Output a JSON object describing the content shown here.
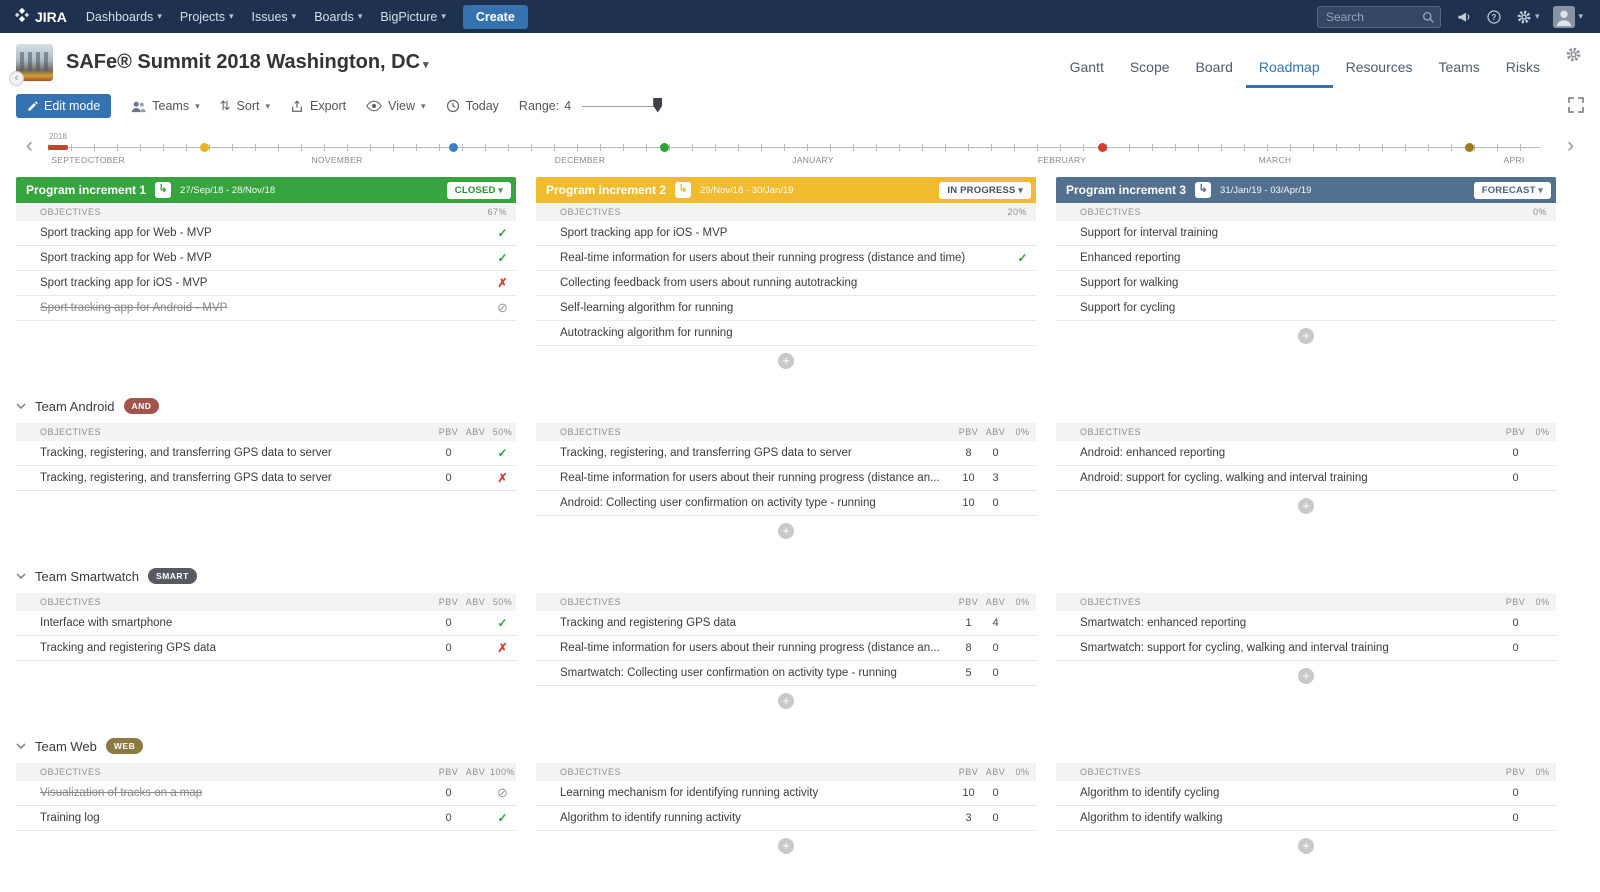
{
  "topnav": {
    "brand": "JIRA",
    "menus": [
      "Dashboards",
      "Projects",
      "Issues",
      "Boards",
      "BigPicture"
    ],
    "create_label": "Create",
    "search_placeholder": "Search"
  },
  "header": {
    "title": "SAFe® Summit 2018 Washington, DC",
    "tabs": [
      "Gantt",
      "Scope",
      "Board",
      "Roadmap",
      "Resources",
      "Teams",
      "Risks"
    ],
    "active_tab": "Roadmap"
  },
  "toolbar": {
    "edit_mode_label": "Edit mode",
    "teams_label": "Teams",
    "sort_label": "Sort",
    "export_label": "Export",
    "view_label": "View",
    "today_label": "Today",
    "range_label": "Range:",
    "range_value": "4"
  },
  "timeline": {
    "year_label": "2018",
    "months": [
      "SEPTE",
      "OCTOBER",
      "NOVEMBER",
      "DECEMBER",
      "JANUARY",
      "FEBRUARY",
      "MARCH",
      "APRI"
    ],
    "marker_colors": [
      "#e8b420",
      "#3b7fc4",
      "#2fa339",
      "#d23f31",
      "#a07d1c"
    ]
  },
  "labels": {
    "objectives": "OBJECTIVES",
    "pbv": "PBV",
    "abv": "ABV"
  },
  "increments": [
    {
      "name": "Program increment 1",
      "dates": "27/Sep/18 - 28/Nov/18",
      "status_label": "CLOSED",
      "color": "#36a53f",
      "status_text_color": "#2e8b36",
      "progress": "67%",
      "has_add": false,
      "objectives": [
        {
          "text": "Sport tracking app for Web - MVP",
          "status": "check"
        },
        {
          "text": "Sport tracking app for Web - MVP",
          "status": "check"
        },
        {
          "text": "Sport tracking app for iOS - MVP",
          "status": "cross"
        },
        {
          "text": "Sport tracking app for Android - MVP",
          "status": "cancelled"
        }
      ]
    },
    {
      "name": "Program increment 2",
      "dates": "29/Nov/18 - 30/Jan/19",
      "status_label": "IN PROGRESS",
      "color": "#f0bc2e",
      "status_text_color": "#454f5b",
      "progress": "20%",
      "has_add": true,
      "objectives": [
        {
          "text": "Sport tracking app for iOS - MVP",
          "status": ""
        },
        {
          "text": "Real-time information for users about their running progress (distance and time)",
          "status": "check"
        },
        {
          "text": "Collecting feedback from users about running autotracking",
          "status": ""
        },
        {
          "text": "Self-learning algorithm for running",
          "status": ""
        },
        {
          "text": "Autotracking algorithm for running",
          "status": ""
        }
      ]
    },
    {
      "name": "Program increment 3",
      "dates": "31/Jan/19 - 03/Apr/19",
      "status_label": "FORECAST",
      "color": "#53718f",
      "status_text_color": "#4a6583",
      "progress": "0%",
      "has_add": true,
      "objectives": [
        {
          "text": "Support for interval training",
          "status": ""
        },
        {
          "text": "Enhanced reporting",
          "status": ""
        },
        {
          "text": "Support for walking",
          "status": ""
        },
        {
          "text": "Support for cycling",
          "status": ""
        }
      ]
    }
  ],
  "teams": [
    {
      "name": "Team Android",
      "badge": "AND",
      "badge_color": "#a0564e",
      "columns": [
        {
          "progress": "50%",
          "show_abv": true,
          "has_add": false,
          "rows": [
            {
              "text": "Tracking, registering, and transferring GPS data to server",
              "pbv": "0",
              "status": "check"
            },
            {
              "text": "Tracking, registering, and transferring GPS data to server",
              "pbv": "0",
              "status": "cross"
            }
          ]
        },
        {
          "progress": "0%",
          "show_abv": true,
          "has_add": true,
          "rows": [
            {
              "text": "Tracking, registering, and transferring GPS data to server",
              "pbv": "8",
              "abv": "0"
            },
            {
              "text": "Real-time information for users about their running progress (distance an...",
              "pbv": "10",
              "abv": "3"
            },
            {
              "text": "Android: Collecting user confirmation on activity type - running",
              "pbv": "10",
              "abv": "0"
            }
          ]
        },
        {
          "progress": "0%",
          "show_abv": false,
          "has_add": true,
          "rows": [
            {
              "text": "Android: enhanced reporting",
              "pbv": "0"
            },
            {
              "text": "Android: support for cycling, walking and interval training",
              "pbv": "0"
            }
          ]
        }
      ]
    },
    {
      "name": "Team Smartwatch",
      "badge": "SMART",
      "badge_color": "#565a61",
      "columns": [
        {
          "progress": "50%",
          "show_abv": true,
          "has_add": false,
          "rows": [
            {
              "text": "Interface with smartphone",
              "pbv": "0",
              "status": "check"
            },
            {
              "text": "Tracking and registering GPS data",
              "pbv": "0",
              "status": "cross"
            }
          ]
        },
        {
          "progress": "0%",
          "show_abv": true,
          "has_add": true,
          "rows": [
            {
              "text": "Tracking and registering GPS data",
              "pbv": "1",
              "abv": "4"
            },
            {
              "text": "Real-time information for users about their running progress (distance an...",
              "pbv": "8",
              "abv": "0"
            },
            {
              "text": "Smartwatch: Collecting user confirmation on activity type - running",
              "pbv": "5",
              "abv": "0"
            }
          ]
        },
        {
          "progress": "0%",
          "show_abv": false,
          "has_add": true,
          "rows": [
            {
              "text": "Smartwatch: enhanced reporting",
              "pbv": "0"
            },
            {
              "text": "Smartwatch: support for cycling, walking and interval training",
              "pbv": "0"
            }
          ]
        }
      ]
    },
    {
      "name": "Team Web",
      "badge": "WEB",
      "badge_color": "#8c7a42",
      "columns": [
        {
          "progress": "100%",
          "show_abv": true,
          "has_add": false,
          "rows": [
            {
              "text": "Visualization of tracks on a map",
              "pbv": "0",
              "status": "cancelled"
            },
            {
              "text": "Training log",
              "pbv": "0",
              "status": "check"
            }
          ]
        },
        {
          "progress": "0%",
          "show_abv": true,
          "has_add": true,
          "rows": [
            {
              "text": "Learning mechanism for identifying running activity",
              "pbv": "10",
              "abv": "0"
            },
            {
              "text": "Algorithm to identify running activity",
              "pbv": "3",
              "abv": "0"
            }
          ]
        },
        {
          "progress": "0%",
          "show_abv": false,
          "has_add": true,
          "rows": [
            {
              "text": "Algorithm to identify cycling",
              "pbv": "0"
            },
            {
              "text": "Algorithm to identify walking",
              "pbv": "0"
            }
          ]
        }
      ]
    }
  ]
}
